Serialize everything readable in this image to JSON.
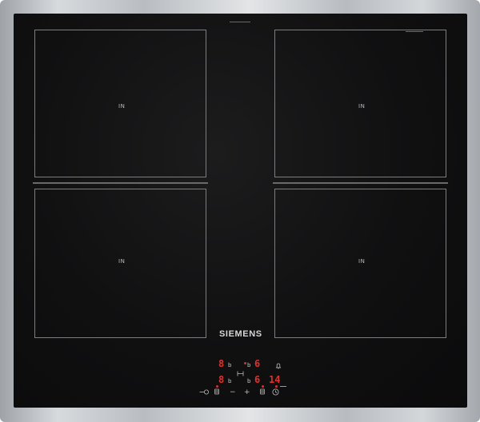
{
  "brand": {
    "name": "SIEMENS"
  },
  "zones": {
    "front_left": {
      "label": "IN"
    },
    "rear_left": {
      "label": "IN"
    },
    "rear_right": {
      "label": "IN"
    },
    "front_right": {
      "label": "IN"
    }
  },
  "display": {
    "row1": {
      "left_level": "8",
      "left_b": "b",
      "right_b": "b",
      "right_level": "6"
    },
    "row2": {
      "left_level": "8",
      "left_b": "b",
      "right_b": "b",
      "right_level": "6",
      "timer": "14"
    }
  },
  "controls": {
    "minus_label": "−",
    "plus_label": "+"
  },
  "icons": [
    "lock-icon",
    "bell-icon",
    "timer-icon",
    "zone-select-icon",
    "bridge-icon"
  ],
  "colors": {
    "display_red": "#e0302a",
    "glass": "#101011"
  }
}
